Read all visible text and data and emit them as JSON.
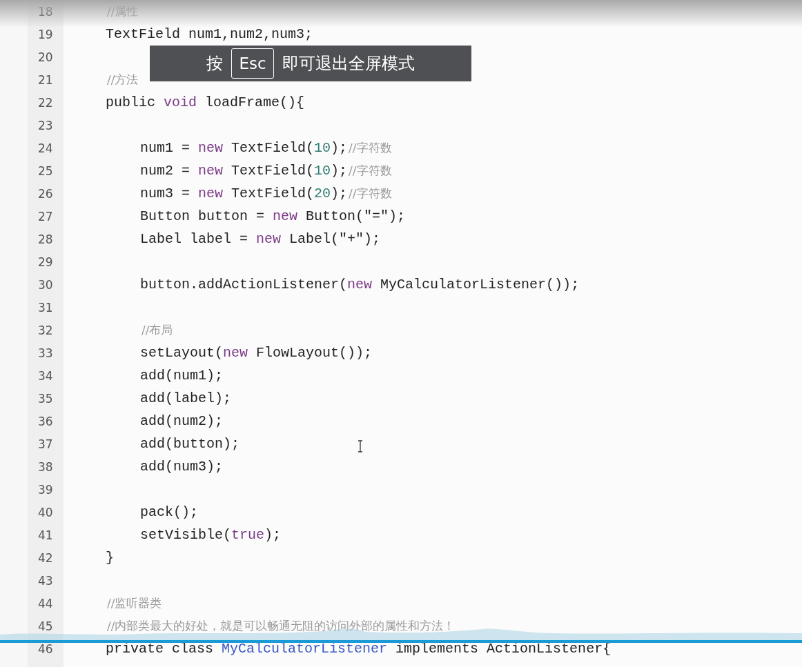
{
  "editor": {
    "lines": [
      {
        "number": "18",
        "tokens": [
          {
            "kind": "comment",
            "text": "//属性"
          }
        ]
      },
      {
        "number": "19",
        "tokens": [
          {
            "kind": "plain",
            "text": "TextField num1,num2,num3;"
          }
        ]
      },
      {
        "number": "20"
      },
      {
        "number": "21",
        "tokens": [
          {
            "kind": "comment",
            "text": "//方法"
          }
        ]
      },
      {
        "number": "22",
        "tokens": [
          {
            "kind": "plain",
            "text": "public "
          },
          {
            "kind": "keyword",
            "text": "void"
          },
          {
            "kind": "plain",
            "text": " loadFrame(){"
          }
        ],
        "children": [
          {
            "number": "23"
          },
          {
            "number": "24",
            "tokens": [
              {
                "kind": "plain",
                "text": "num1 = "
              },
              {
                "kind": "keyword",
                "text": "new"
              },
              {
                "kind": "plain",
                "text": " TextField("
              },
              {
                "kind": "number",
                "text": "10"
              },
              {
                "kind": "plain",
                "text": ");"
              },
              {
                "kind": "comment",
                "text": "//字符数"
              }
            ]
          },
          {
            "number": "25",
            "tokens": [
              {
                "kind": "plain",
                "text": "num2 = "
              },
              {
                "kind": "keyword",
                "text": "new"
              },
              {
                "kind": "plain",
                "text": " TextField("
              },
              {
                "kind": "number",
                "text": "10"
              },
              {
                "kind": "plain",
                "text": ");"
              },
              {
                "kind": "comment",
                "text": "//字符数"
              }
            ]
          },
          {
            "number": "26",
            "tokens": [
              {
                "kind": "plain",
                "text": "num3 = "
              },
              {
                "kind": "keyword",
                "text": "new"
              },
              {
                "kind": "plain",
                "text": " TextField("
              },
              {
                "kind": "number",
                "text": "20"
              },
              {
                "kind": "plain",
                "text": ");"
              },
              {
                "kind": "comment",
                "text": "//字符数"
              }
            ]
          },
          {
            "number": "27",
            "tokens": [
              {
                "kind": "plain",
                "text": "Button button = "
              },
              {
                "kind": "keyword",
                "text": "new"
              },
              {
                "kind": "plain",
                "text": " Button(\"=\");"
              }
            ]
          },
          {
            "number": "28",
            "tokens": [
              {
                "kind": "plain",
                "text": "Label label = "
              },
              {
                "kind": "keyword",
                "text": "new"
              },
              {
                "kind": "plain",
                "text": " Label(\"+\");"
              }
            ]
          },
          {
            "number": "29"
          },
          {
            "number": "30",
            "tokens": [
              {
                "kind": "plain",
                "text": "button.addActionListener("
              },
              {
                "kind": "keyword",
                "text": "new"
              },
              {
                "kind": "plain",
                "text": " MyCalculatorListener());"
              }
            ]
          },
          {
            "number": "31"
          },
          {
            "number": "32",
            "tokens": [
              {
                "kind": "comment",
                "text": "//布局"
              }
            ]
          },
          {
            "number": "33",
            "tokens": [
              {
                "kind": "plain",
                "text": "setLayout("
              },
              {
                "kind": "keyword",
                "text": "new"
              },
              {
                "kind": "plain",
                "text": " FlowLayout());"
              }
            ]
          },
          {
            "number": "34",
            "tokens": [
              {
                "kind": "plain",
                "text": "add(num1);"
              }
            ]
          },
          {
            "number": "35",
            "tokens": [
              {
                "kind": "plain",
                "text": "add(label);"
              }
            ]
          },
          {
            "number": "36",
            "tokens": [
              {
                "kind": "plain",
                "text": "add(num2);"
              }
            ]
          },
          {
            "number": "37",
            "tokens": [
              {
                "kind": "plain",
                "text": "add(button);"
              }
            ]
          },
          {
            "number": "38",
            "tokens": [
              {
                "kind": "plain",
                "text": "add(num3);"
              }
            ]
          },
          {
            "number": "39"
          },
          {
            "number": "40",
            "tokens": [
              {
                "kind": "plain",
                "text": "pack();"
              }
            ]
          },
          {
            "number": "41",
            "tokens": [
              {
                "kind": "plain",
                "text": "setVisible("
              },
              {
                "kind": "keyword",
                "text": "true"
              },
              {
                "kind": "plain",
                "text": ");"
              }
            ]
          }
        ]
      },
      {
        "number": "42",
        "tokens": [
          {
            "kind": "plain",
            "text": "}"
          }
        ]
      },
      {
        "number": "43"
      },
      {
        "number": "44",
        "tokens": [
          {
            "kind": "comment",
            "text": "//监听器类"
          }
        ]
      },
      {
        "number": "45",
        "tokens": [
          {
            "kind": "comment",
            "text": "//内部类最大的好处，就是可以畅通无阻的访问外部的属性和方法！"
          }
        ]
      },
      {
        "number": "46",
        "tokens": [
          {
            "kind": "plain",
            "text": "private class "
          },
          {
            "kind": "type",
            "text": "MyCalculatorListener"
          },
          {
            "kind": "plain",
            "text": " implements ActionListener{"
          }
        ]
      }
    ]
  },
  "fullscreen_notice": {
    "before": "按",
    "key": "Esc",
    "after": "即可退出全屏模式"
  }
}
